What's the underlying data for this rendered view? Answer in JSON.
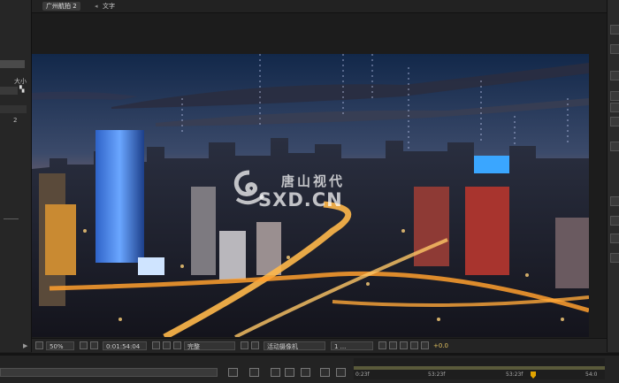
{
  "tabs": {
    "comp": "广州航拍 2",
    "sep": "◂",
    "text": "文字"
  },
  "left_panel": {
    "label_size": "大小",
    "value": "2"
  },
  "watermark": {
    "line1": "唐山视代",
    "line2": "SXD.CN"
  },
  "viewer_toolbar": {
    "zoom": "50%",
    "timecode": "0:01:54:04",
    "resolution": "完整",
    "camera": "活动摄像机",
    "views": "1 ...",
    "exposure": "+0.0"
  },
  "timeline": {
    "t1": "0:23f",
    "t2": "53:23f",
    "t3": "53:23f",
    "t4": "54:0"
  },
  "colors": {
    "accent": "#e2a400",
    "panel": "#262626"
  }
}
